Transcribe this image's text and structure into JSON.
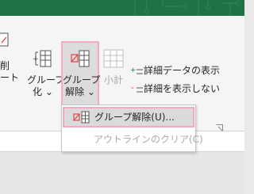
{
  "ribbon": {
    "cut_left_label_1": "削",
    "cut_left_label_2": "ート",
    "group_button": {
      "line1": "グループ",
      "line2": "化 ⌄"
    },
    "ungroup_button": {
      "line1": "グループ",
      "line2": "解除 ⌄"
    },
    "subtotal_button": {
      "label": "小計"
    },
    "show_detail": "詳細データの表示",
    "hide_detail": "詳細を表示しない"
  },
  "menu": {
    "items": [
      {
        "label": "グループ解除(U)...",
        "state": "highlighted"
      },
      {
        "label": "アウトラインのクリア(C)",
        "state": "disabled"
      }
    ]
  },
  "colors": {
    "titlebar": "#1f7244",
    "highlight_border": "#f4a7c6",
    "icon_red": "#e23f3f",
    "disabled_text": "#ababab"
  }
}
